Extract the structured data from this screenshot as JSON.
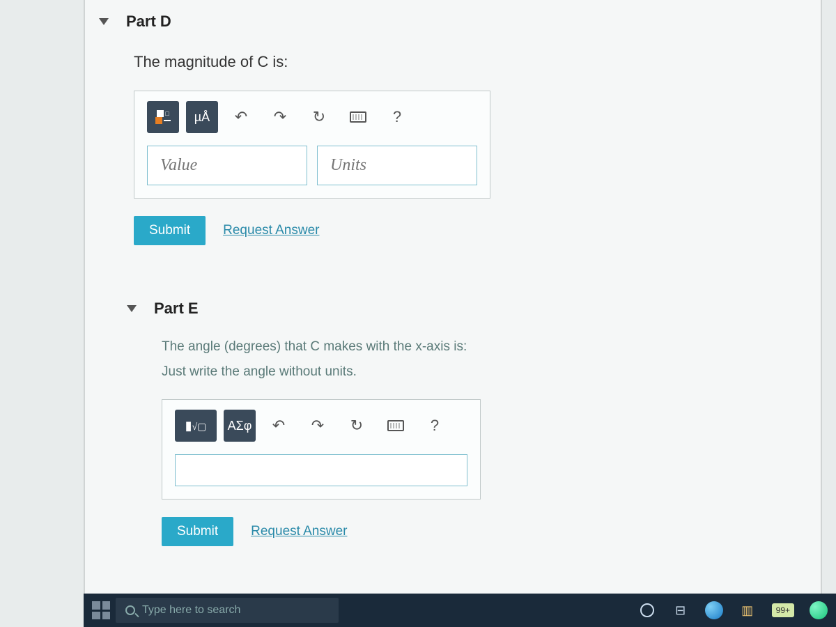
{
  "partD": {
    "title": "Part D",
    "prompt": "The magnitude of C is:",
    "toolbar": {
      "templates_label": "templates",
      "special_chars": "µÅ",
      "undo": "↶",
      "redo": "↷",
      "reset": "↻",
      "keyboard": "keyboard",
      "help": "?"
    },
    "value_placeholder": "Value",
    "units_placeholder": "Units",
    "submit": "Submit",
    "request": "Request Answer"
  },
  "partE": {
    "title": "Part E",
    "prompt1": "The angle (degrees) that C makes with the x-axis is:",
    "prompt2": "Just write the angle without units.",
    "toolbar": {
      "sqrt": "√",
      "greek": "ΑΣφ",
      "undo": "↶",
      "redo": "↷",
      "reset": "↻",
      "keyboard": "keyboard",
      "help": "?"
    },
    "submit": "Submit",
    "request": "Request Answer"
  },
  "taskbar": {
    "search_placeholder": "Type here to search",
    "badge": "99+"
  }
}
